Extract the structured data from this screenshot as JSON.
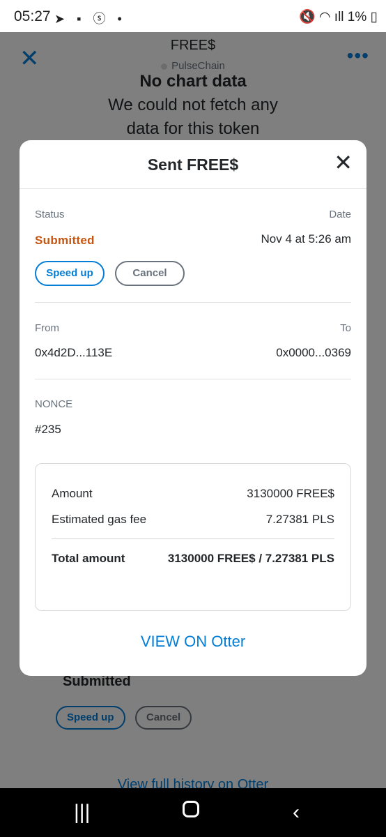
{
  "statusbar": {
    "time": "05:27",
    "left_icons": "➤ ▪ ⓢ •",
    "right_icons": "🔇 ◠ ıll 1% ▯"
  },
  "background": {
    "title": "FREE$",
    "network": "PulseChain",
    "chart_heading": "No chart data",
    "chart_message_line1": "We could not fetch any",
    "chart_message_line2": "data for this token",
    "tx_status": "Submitted",
    "speed_up": "Speed up",
    "cancel": "Cancel",
    "view_history": "View full history on Otter"
  },
  "modal": {
    "title": "Sent FREE$",
    "status_label": "Status",
    "status_value": "Submitted",
    "date_label": "Date",
    "date_value": "Nov 4 at 5:26 am",
    "speed_up_label": "Speed up",
    "cancel_label": "Cancel",
    "from_label": "From",
    "from_value": "0x4d2D...113E",
    "to_label": "To",
    "to_value": "0x0000...0369",
    "nonce_label": "NONCE",
    "nonce_value": "#235",
    "summary": {
      "amount_label": "Amount",
      "amount_value": "3130000 FREE$",
      "gas_label": "Estimated gas fee",
      "gas_value": "7.27381 PLS",
      "total_label": "Total amount",
      "total_value": "3130000 FREE$ / 7.27381 PLS"
    },
    "view_link": "VIEW ON Otter"
  },
  "colors": {
    "accent": "#037dd6",
    "status_submitted": "#c65512",
    "text": "#24272a",
    "muted": "#6a737d"
  }
}
